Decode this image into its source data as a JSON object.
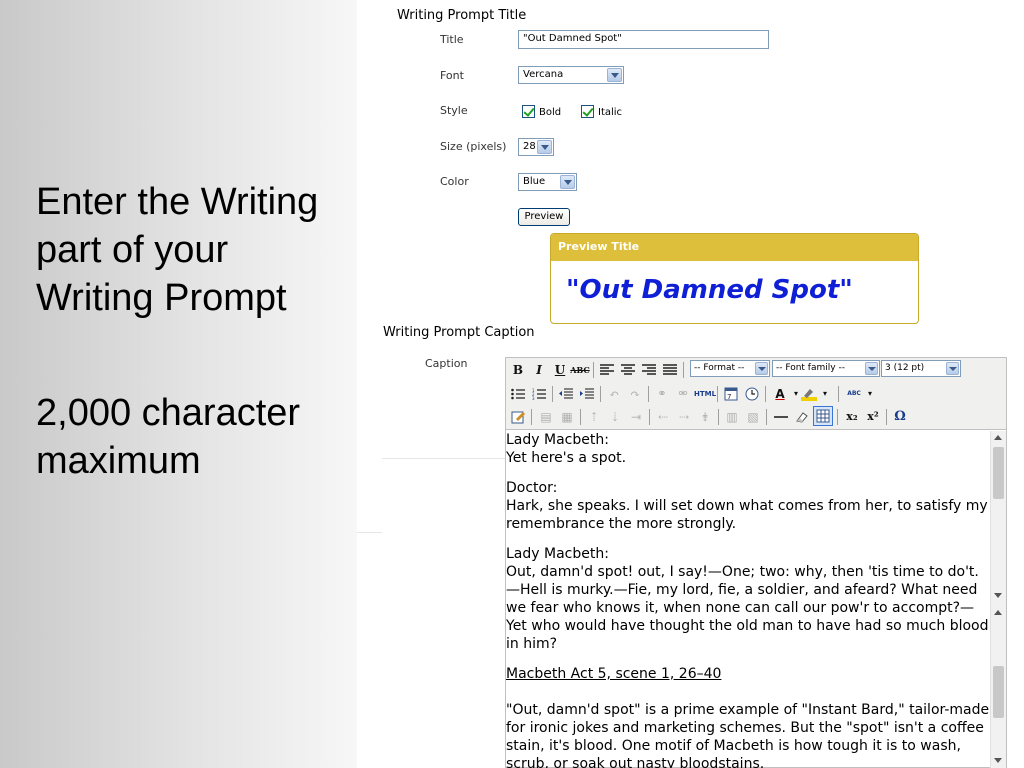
{
  "slide": {
    "instruction": "Enter the Writing part of your Writing Prompt",
    "limit": "2,000 character maximum"
  },
  "title_section": {
    "heading": "Writing Prompt Title",
    "title_label": "Title",
    "title_value": "\"Out Damned Spot\"",
    "font_label": "Font",
    "font_value": "Vercana",
    "style_label": "Style",
    "bold_label": "Bold",
    "bold_checked": true,
    "italic_label": "Italic",
    "italic_checked": true,
    "size_label": "Size (pixels)",
    "size_value": "28",
    "color_label": "Color",
    "color_value": "Blue",
    "preview_button": "Preview"
  },
  "preview": {
    "header": "Preview Title",
    "title_text": "\"Out Damned Spot\"",
    "text_color": "#0f1fd6",
    "header_color": "#ddbf3b"
  },
  "caption_section": {
    "heading": "Writing Prompt Caption",
    "caption_label": "Caption"
  },
  "toolbar": {
    "row1": {
      "bold": "B",
      "italic": "I",
      "underline": "U",
      "strikethrough": "ABC",
      "format_select": "-- Format --",
      "font_family_select": "-- Font family --",
      "font_size_select": "3 (12 pt)"
    },
    "row2": {
      "html": "HTML",
      "spellcheck": "ABC"
    },
    "row3": {
      "subscript": "x₂",
      "superscript": "x²",
      "omega": "Ω"
    }
  },
  "editor_content": {
    "p1_speaker": "Lady Macbeth:",
    "p1_line": "Yet here's a spot.",
    "p2_speaker": "Doctor:",
    "p2_line": "Hark, she speaks. I will set down what comes from her, to satisfy my remembrance the more strongly.",
    "p3_speaker": "Lady Macbeth:",
    "p3_line": "Out, damn'd spot! out, I say!—One; two: why, then 'tis time to do't.—Hell is murky.—Fie, my lord, fie, a soldier, and afeard? What need we fear who knows it, when none can call our pow'r to accompt?—Yet who would have thought the old man to have had so much blood in him?",
    "citation": "Macbeth Act 5, scene 1, 26–40",
    "commentary": "\"Out, damn'd spot\" is a prime example of \"Instant Bard,\" tailor-made for ironic jokes and marketing schemes. But the \"spot\" isn't a coffee stain, it's blood. One motif of Macbeth is how tough it is to wash, scrub, or soak out nasty bloodstains."
  }
}
